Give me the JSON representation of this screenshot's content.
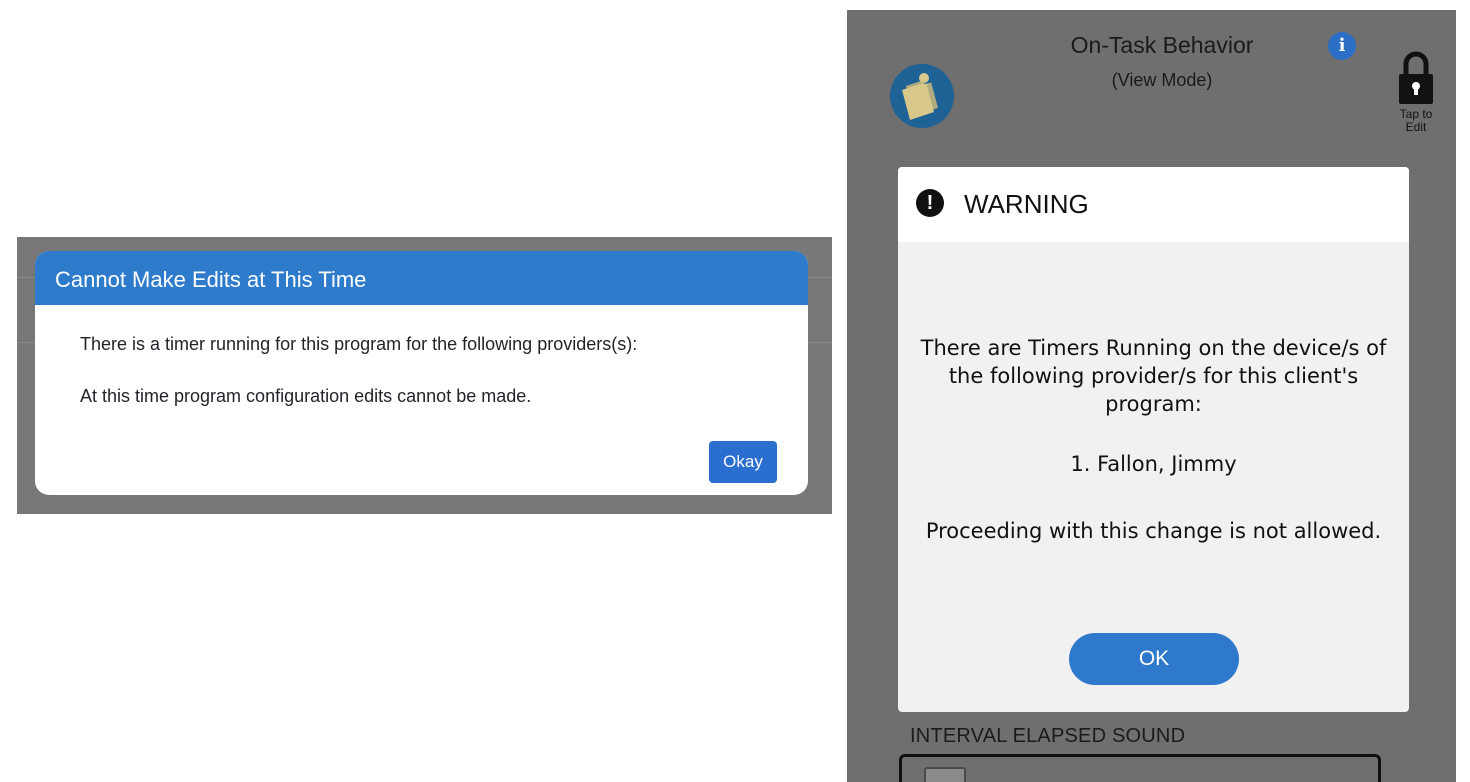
{
  "web_modal": {
    "title": "Cannot Make Edits at This Time",
    "message_1": "There is a timer running for this program for the following providers(s):",
    "message_2": "At this time program configuration edits cannot be made.",
    "okay_label": "Okay"
  },
  "app_header": {
    "title": "On-Task Behavior",
    "subtitle": "(View Mode)",
    "info_icon_glyph": "i",
    "lock_label_line1": "Tap to",
    "lock_label_line2": "Edit"
  },
  "warning_dialog": {
    "icon_glyph": "!",
    "title": "WARNING",
    "message_line1": "There are Timers Running on the device/s of",
    "message_line2": "the following provider/s for this client's",
    "message_line3": "program:",
    "provider_1": "1. Fallon, Jimmy",
    "footer_message": "Proceeding with this change is not allowed.",
    "ok_label": "OK"
  },
  "settings": {
    "interval_label": "INTERVAL ELAPSED SOUND"
  },
  "colors": {
    "web_modal_header": "#2f7bcb",
    "okay_button": "#2a6fd0",
    "overlay_gray": "#6f6f6f",
    "ok_button": "#2f79cd"
  }
}
